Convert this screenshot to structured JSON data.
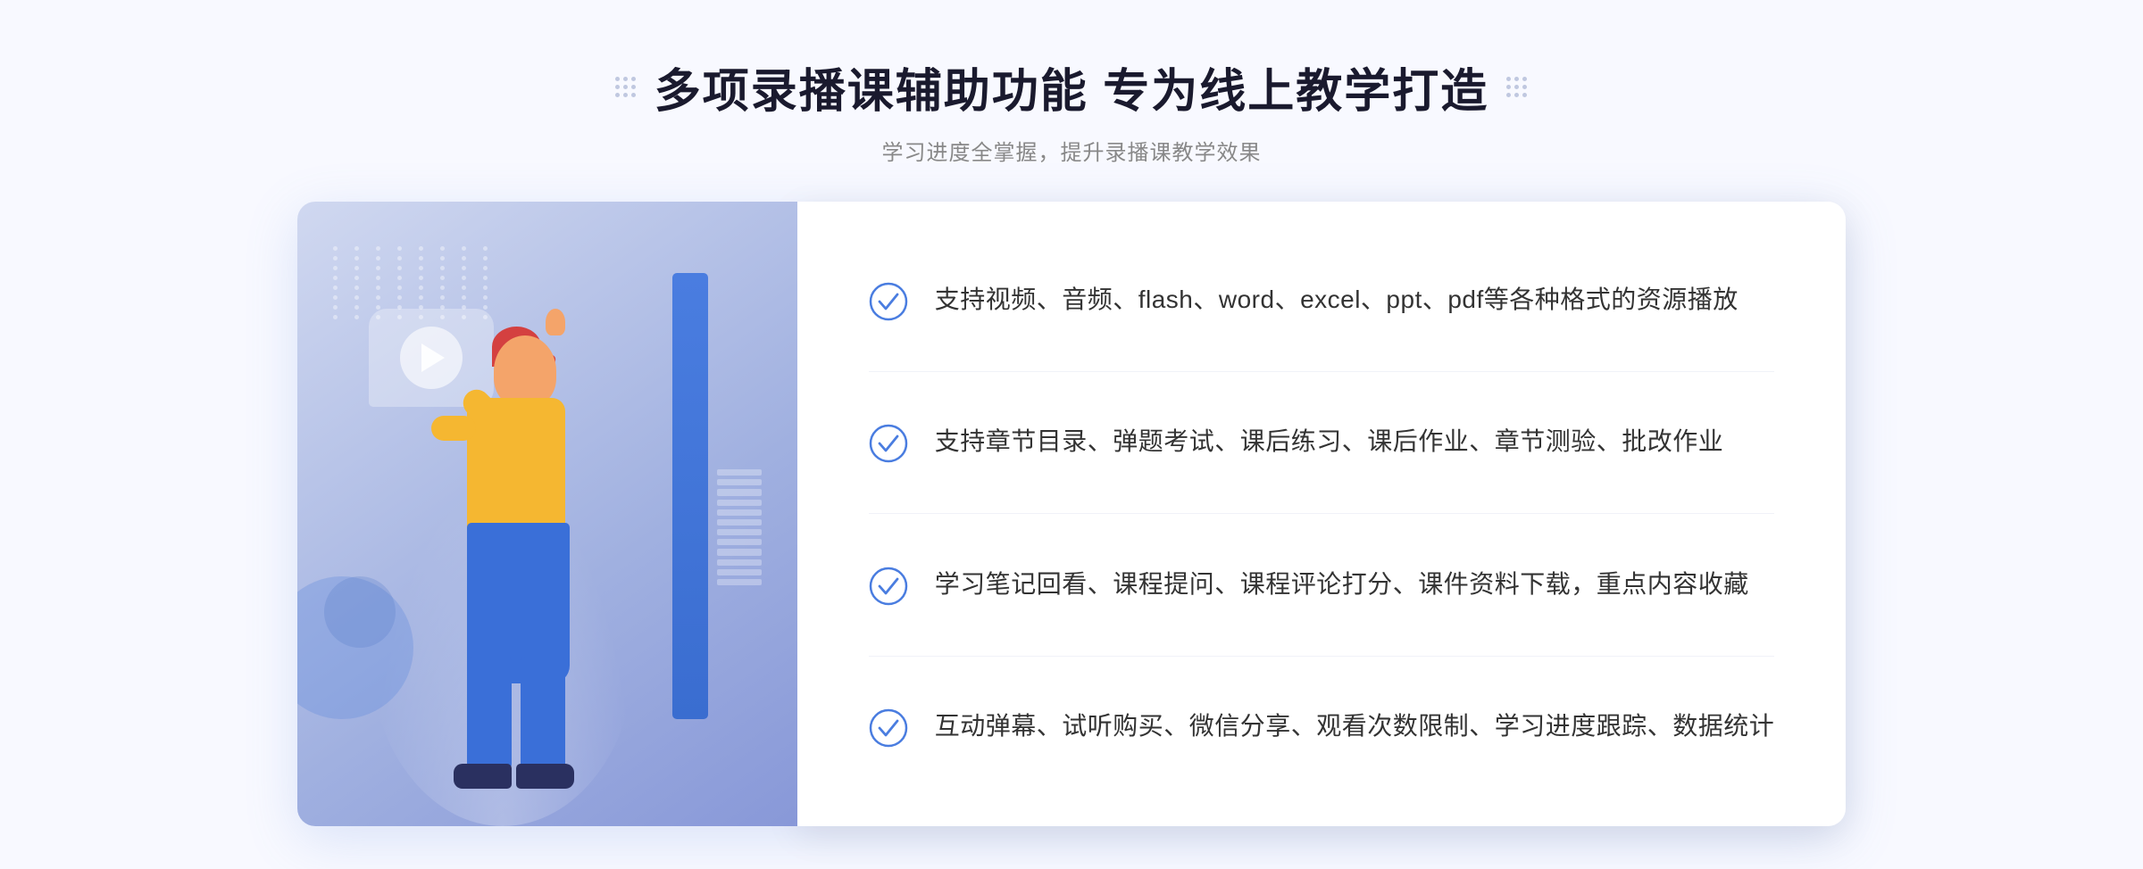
{
  "header": {
    "title": "多项录播课辅助功能 专为线上教学打造",
    "subtitle": "学习进度全掌握，提升录播课教学效果"
  },
  "features": [
    {
      "id": 1,
      "text": "支持视频、音频、flash、word、excel、ppt、pdf等各种格式的资源播放"
    },
    {
      "id": 2,
      "text": "支持章节目录、弹题考试、课后练习、课后作业、章节测验、批改作业"
    },
    {
      "id": 3,
      "text": "学习笔记回看、课程提问、课程评论打分、课件资料下载，重点内容收藏"
    },
    {
      "id": 4,
      "text": "互动弹幕、试听购买、微信分享、观看次数限制、学习进度跟踪、数据统计"
    }
  ],
  "colors": {
    "accent_blue": "#4a7de0",
    "light_blue_bg": "#dde6f8",
    "text_dark": "#222222",
    "text_gray": "#888888",
    "check_blue": "#4a7de0"
  },
  "icons": {
    "check_circle": "check-circle-icon",
    "left_chevrons": "«",
    "play": "▶"
  }
}
